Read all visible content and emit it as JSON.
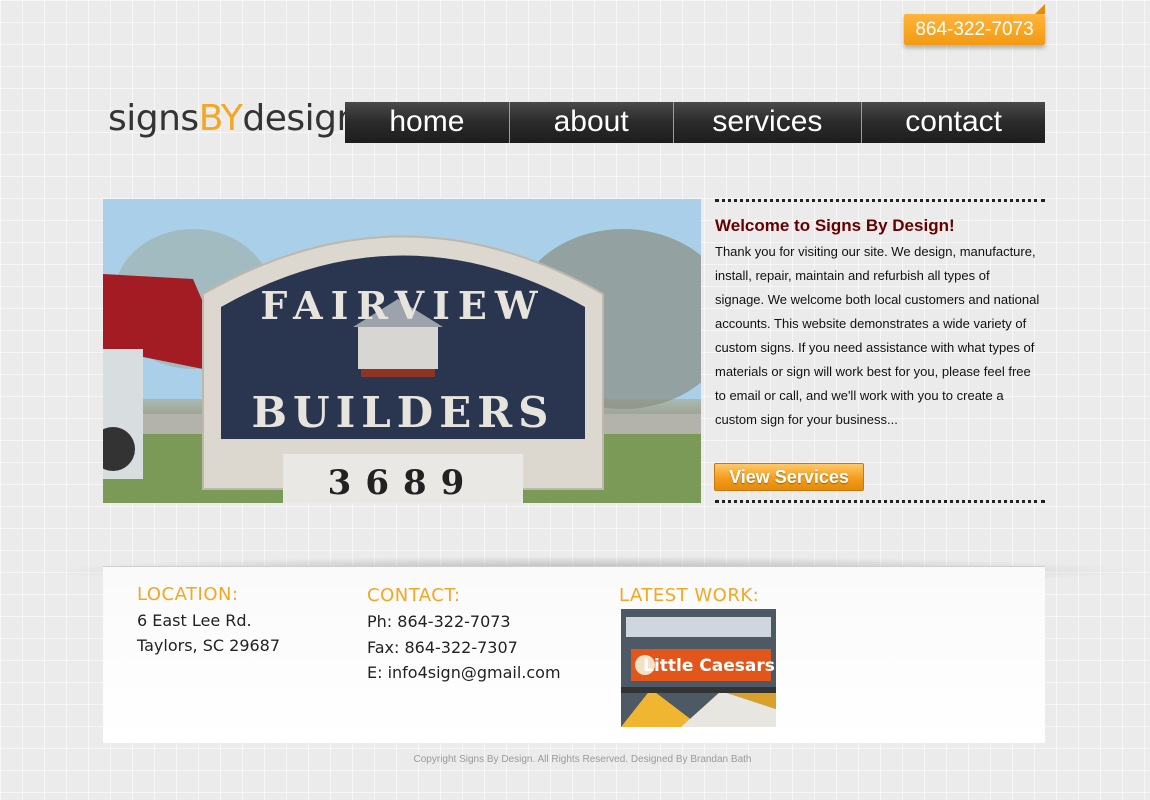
{
  "header": {
    "phone": "864-322-7073",
    "logo": {
      "part1": "signs",
      "part2": "BY",
      "part3": "design"
    }
  },
  "nav": {
    "items": [
      {
        "label": "home"
      },
      {
        "label": "about"
      },
      {
        "label": "services"
      },
      {
        "label": "contact"
      }
    ]
  },
  "hero": {
    "sign_line1": "FAIRVIEW",
    "sign_line2": "BUILDERS",
    "sign_number": "3689"
  },
  "welcome": {
    "title": "Welcome to Signs By Design!",
    "body": "Thank you for visiting our site. We design, manufacture, install, repair, maintain and refurbish all types of signage. We welcome both local customers and national accounts. This website demonstrates a wide variety of custom signs. If you need assistance with what types of materials or sign will work best for you, please feel free to email or call, and we'll work with you to create a custom sign for your business...",
    "button": "View Services"
  },
  "footer": {
    "location": {
      "heading": "LOCATION:",
      "line1": "6 East Lee Rd.",
      "line2": "Taylors, SC 29687"
    },
    "contact": {
      "heading": "CONTACT:",
      "phone": "Ph: 864-322-7073",
      "fax": "Fax: 864-322-7307",
      "email": "E: info4sign@gmail.com"
    },
    "latest": {
      "heading": "LATEST WORK:",
      "image_text": "Little Caesars"
    }
  },
  "copyright": "Copyright Signs By Design. All Rights Reserved. Designed By Brandan Bath",
  "colors": {
    "accent_orange": "#f5a623",
    "title_red": "#660000",
    "nav_dark": "#2a2a2a"
  }
}
